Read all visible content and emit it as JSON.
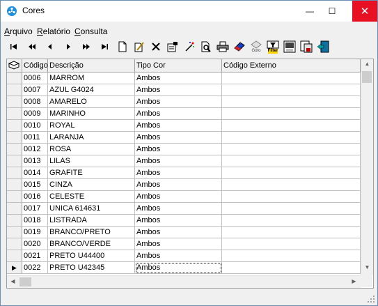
{
  "window": {
    "title": "Cores",
    "min_glyph": "—",
    "max_glyph": "☐",
    "close_glyph": "✕"
  },
  "menu": {
    "items": [
      "Arquivo",
      "Relatório",
      "Consulta"
    ]
  },
  "toolbar": {
    "buttons": [
      {
        "name": "first-record-icon",
        "glyph": "⏮"
      },
      {
        "name": "prior-page-icon",
        "glyph": "⏪"
      },
      {
        "name": "prior-record-icon",
        "glyph": "◀"
      },
      {
        "name": "next-record-icon",
        "glyph": "▶"
      },
      {
        "name": "next-page-icon",
        "glyph": "⏩"
      },
      {
        "name": "last-record-icon",
        "glyph": "⏭"
      },
      {
        "name": "new-document-icon",
        "glyph": "🗋"
      },
      {
        "name": "edit-document-icon",
        "glyph": "✎"
      },
      {
        "name": "delete-icon",
        "glyph": "✕"
      },
      {
        "name": "properties-icon",
        "glyph": "▤"
      },
      {
        "name": "wand-icon",
        "glyph": "✦"
      },
      {
        "name": "preview-icon",
        "glyph": "🔍"
      },
      {
        "name": "print-icon",
        "glyph": "⎙"
      },
      {
        "name": "eraser-icon",
        "glyph": "◆"
      },
      {
        "name": "goto-icon",
        "glyph": "➜"
      },
      {
        "name": "filter-icon",
        "glyph": "▼"
      },
      {
        "name": "export-icon",
        "glyph": "▣"
      },
      {
        "name": "save-icon",
        "glyph": "▦"
      },
      {
        "name": "exit-icon",
        "glyph": "⇥"
      }
    ],
    "goto_label": "Goto",
    "filter_label": "Filter"
  },
  "grid": {
    "columns": [
      "Código",
      "Descrição",
      "Tipo Cor",
      "Código Externo"
    ],
    "current_row_glyph": "▶",
    "rows": [
      {
        "codigo": "0006",
        "descricao": "MARROM",
        "tipo": "Ambos",
        "externo": ""
      },
      {
        "codigo": "0007",
        "descricao": "AZUL G4024",
        "tipo": "Ambos",
        "externo": ""
      },
      {
        "codigo": "0008",
        "descricao": "AMARELO",
        "tipo": "Ambos",
        "externo": ""
      },
      {
        "codigo": "0009",
        "descricao": "MARINHO",
        "tipo": "Ambos",
        "externo": ""
      },
      {
        "codigo": "0010",
        "descricao": "ROYAL",
        "tipo": "Ambos",
        "externo": ""
      },
      {
        "codigo": "0011",
        "descricao": "LARANJA",
        "tipo": "Ambos",
        "externo": ""
      },
      {
        "codigo": "0012",
        "descricao": "ROSA",
        "tipo": "Ambos",
        "externo": ""
      },
      {
        "codigo": "0013",
        "descricao": "LILAS",
        "tipo": "Ambos",
        "externo": ""
      },
      {
        "codigo": "0014",
        "descricao": "GRAFITE",
        "tipo": "Ambos",
        "externo": ""
      },
      {
        "codigo": "0015",
        "descricao": "CINZA",
        "tipo": "Ambos",
        "externo": ""
      },
      {
        "codigo": "0016",
        "descricao": "CELESTE",
        "tipo": "Ambos",
        "externo": ""
      },
      {
        "codigo": "0017",
        "descricao": "UNICA 614631",
        "tipo": "Ambos",
        "externo": ""
      },
      {
        "codigo": "0018",
        "descricao": "LISTRADA",
        "tipo": "Ambos",
        "externo": ""
      },
      {
        "codigo": "0019",
        "descricao": "BRANCO/PRETO",
        "tipo": "Ambos",
        "externo": ""
      },
      {
        "codigo": "0020",
        "descricao": "BRANCO/VERDE",
        "tipo": "Ambos",
        "externo": ""
      },
      {
        "codigo": "0021",
        "descricao": "PRETO U44400",
        "tipo": "Ambos",
        "externo": ""
      },
      {
        "codigo": "0022",
        "descricao": "PRETO U42345",
        "tipo": "Ambos",
        "externo": "",
        "current": true
      }
    ]
  },
  "colors": {
    "close_button": "#e81123",
    "accent": "#1c8fe0"
  }
}
